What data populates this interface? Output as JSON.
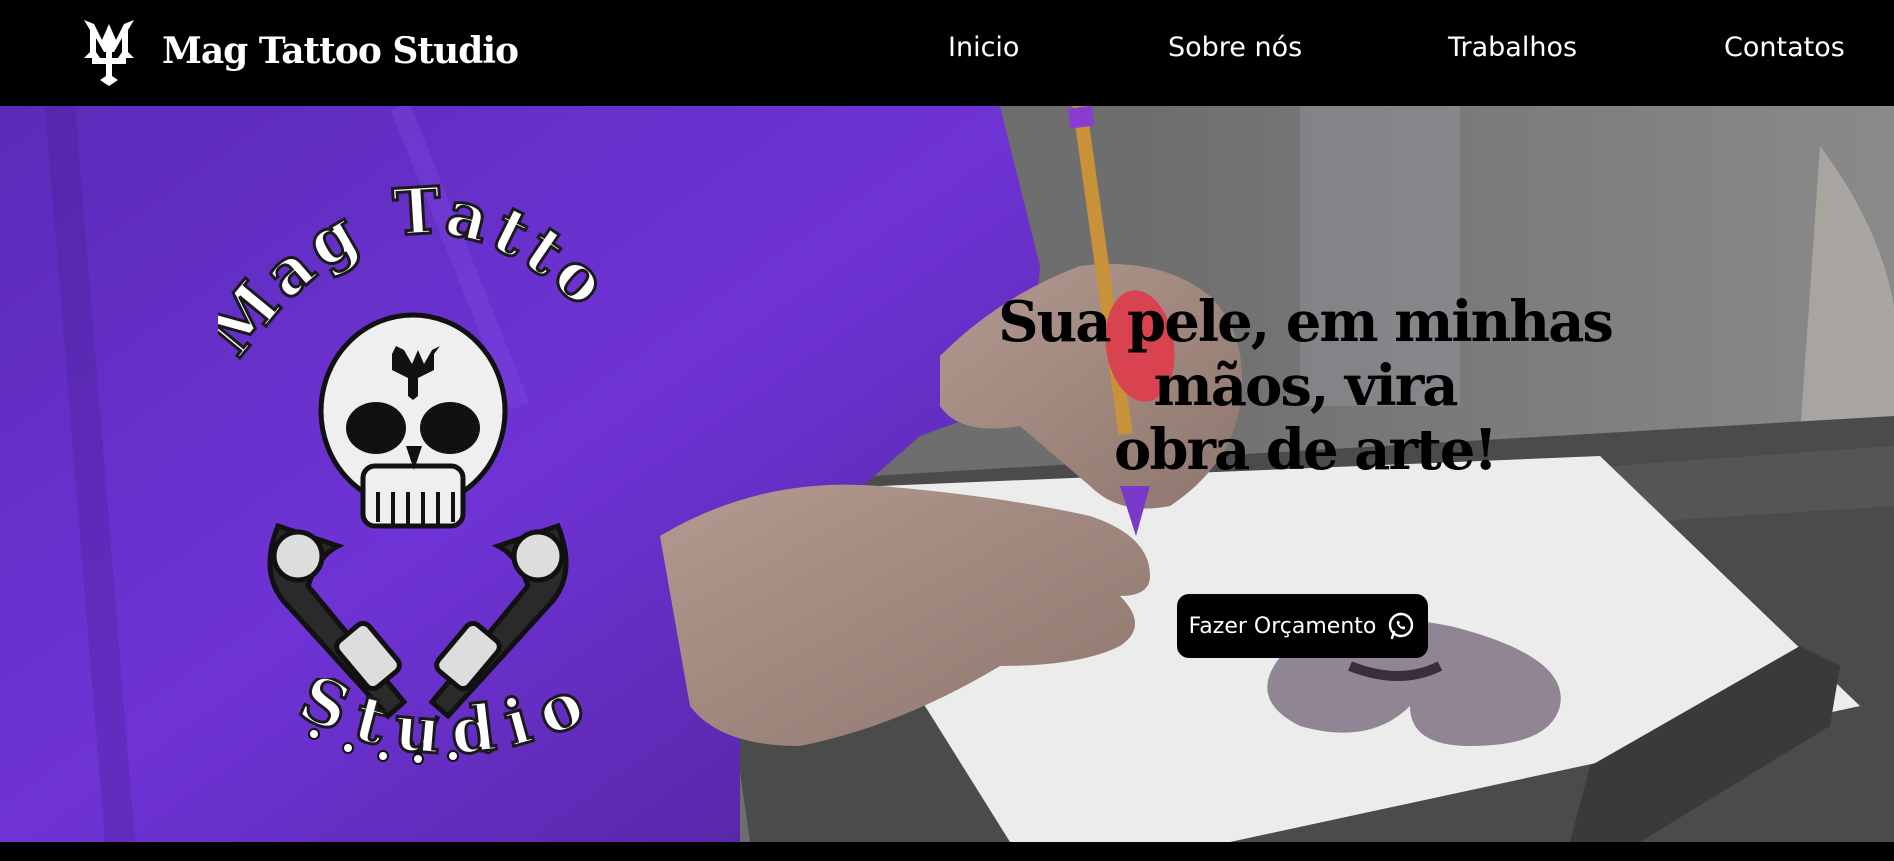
{
  "header": {
    "brand_name": "Mag Tattoo Studio",
    "nav": [
      "Inicio",
      "Sobre nós",
      "Trabalhos",
      "Contatos"
    ]
  },
  "hero": {
    "headline_line1": "Sua pele, em minhas mãos, vira",
    "headline_line2": "obra de arte!",
    "cta_label": "Fazer Orçamento",
    "cta_icon": "whatsapp-icon",
    "logo_top_text": "Mag Tattoo",
    "logo_bottom_text": "Studio",
    "logo_icon": "skull-crossed-tattoo-machines-icon"
  },
  "colors": {
    "nav_bg": "#000000",
    "shirt_purple": "#6a2fd0",
    "paper": "#e9e7ea",
    "text_dark": "#000000",
    "text_light": "#ffffff"
  }
}
